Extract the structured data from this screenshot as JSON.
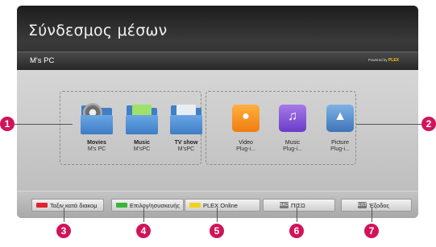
{
  "header": {
    "title": "Σύνδεσμος μέσων",
    "source": "M's PC",
    "powered_text": "Powered by",
    "powered_brand": "PLEX"
  },
  "media_folders": [
    {
      "title": "Movies",
      "subtitle": "M's PC",
      "icon": "movie-folder-icon"
    },
    {
      "title": "Music",
      "subtitle": "M'sPC",
      "icon": "music-folder-icon"
    },
    {
      "title": "TV show",
      "subtitle": "M'sPC",
      "icon": "tv-folder-icon"
    }
  ],
  "plugins": [
    {
      "title": "Video",
      "subtitle": "Plug-i...",
      "icon": "video-camera-icon",
      "glyph": "●"
    },
    {
      "title": "Music",
      "subtitle": "Plug-i...",
      "icon": "music-note-icon",
      "glyph": "♫"
    },
    {
      "title": "Picture",
      "subtitle": "Plug-i...",
      "icon": "picture-icon",
      "glyph": "▲"
    }
  ],
  "buttons": [
    {
      "label": "Ταξιν κατά διακομ",
      "color": "#e0232d",
      "key_glyph": ""
    },
    {
      "label": "Επιλογ/ησυσκευής",
      "color": "#3cb43c",
      "key_glyph": ""
    },
    {
      "label": "PLEX Online",
      "color": "#f2d21a",
      "key_glyph": ""
    },
    {
      "label": "ΠΙΣΩ",
      "color": "",
      "key_glyph": "BACK"
    },
    {
      "label": "Έξοδος",
      "color": "",
      "key_glyph": "EXIT"
    }
  ],
  "callouts": [
    "1",
    "2",
    "3",
    "4",
    "5",
    "6",
    "7"
  ],
  "colors": {
    "callout": "#d1145a",
    "header": "#2a2a2a",
    "background": "#c0c0c0"
  }
}
